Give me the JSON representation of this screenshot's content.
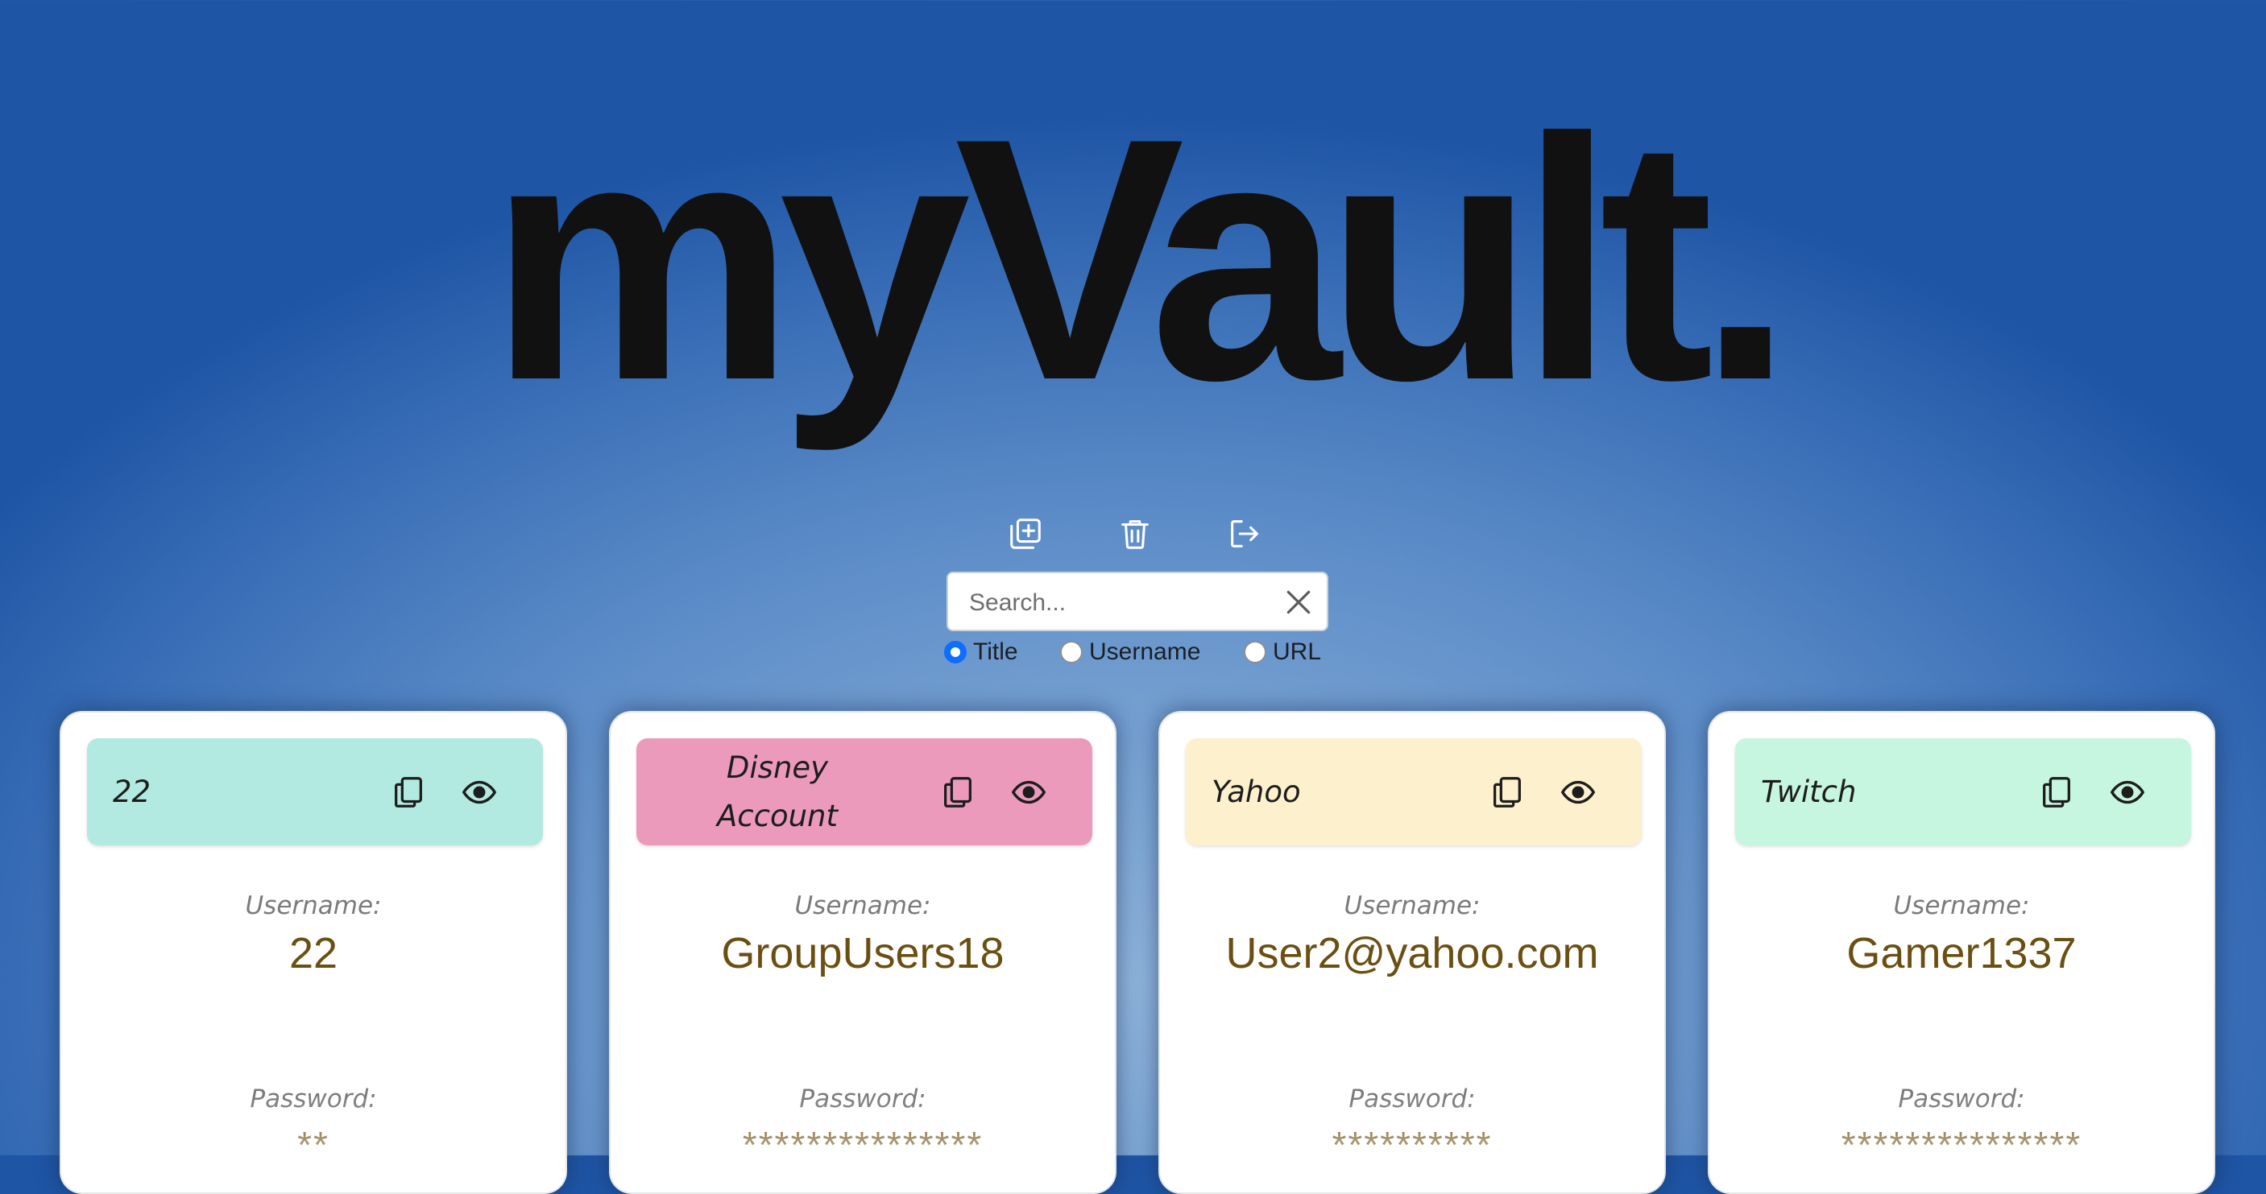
{
  "app": {
    "logo": "myVault."
  },
  "toolbar": {
    "buttons": [
      {
        "name": "add-entry-button",
        "icon": "add-copy-icon"
      },
      {
        "name": "delete-button",
        "icon": "trash-icon"
      },
      {
        "name": "logout-button",
        "icon": "logout-icon"
      }
    ]
  },
  "search": {
    "placeholder": "Search...",
    "value": "",
    "clear_icon": "close-icon"
  },
  "filters": {
    "selected": "Title",
    "options": [
      "Title",
      "Username",
      "URL"
    ]
  },
  "cards": [
    {
      "title": "22",
      "header_color": "#b2e9e0",
      "username_label": "Username:",
      "username": "22",
      "password_label": "Password:",
      "password": "**"
    },
    {
      "title": "Disney Account",
      "header_color": "#ec9abb",
      "username_label": "Username:",
      "username": "GroupUsers18",
      "password_label": "Password:",
      "password": "***************"
    },
    {
      "title": "Yahoo",
      "header_color": "#fdf0cd",
      "username_label": "Username:",
      "username": "User2@yahoo.com",
      "password_label": "Password:",
      "password": "**********"
    },
    {
      "title": "Twitch",
      "header_color": "#c6f5e0",
      "username_label": "Username:",
      "username": "Gamer1337",
      "password_label": "Password:",
      "password": "***************"
    }
  ],
  "colors": {
    "accent": "#0d6efd",
    "value_text": "#6b4f12",
    "logo_text": "#111111"
  }
}
